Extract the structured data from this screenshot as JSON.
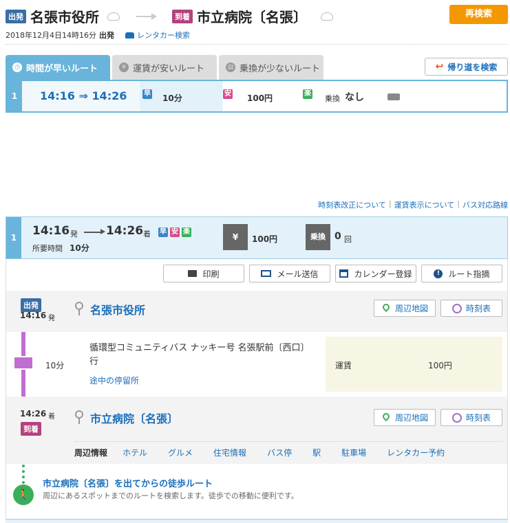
{
  "header": {
    "dep_badge": "出発",
    "dep_station": "名張市役所",
    "arr_badge": "到着",
    "arr_station": "市立病院〔名張〕",
    "research_button": "再検索",
    "datetime": "2018年12月4日14時16分",
    "datetime_suffix": "出発",
    "rental_link": "レンタカー検索"
  },
  "tabs": [
    {
      "label": "時間が早いルート",
      "icon": "clock-icon"
    },
    {
      "label": "運賃が安いルート",
      "icon": "yen-icon"
    },
    {
      "label": "乗換が少ないルート",
      "icon": "transfer-icon"
    }
  ],
  "return_button": "帰り道を検索",
  "summary": {
    "num": "1",
    "time": "14:16 ⇒ 14:26",
    "haya": "早",
    "duration": "10分",
    "yasu": "安",
    "fare": "100円",
    "raku": "楽",
    "transfer_label": "乗換",
    "transfer_value": "なし"
  },
  "links": {
    "timetable_revision": "時刻表改正について",
    "fare_display": "運賃表示について",
    "bus_lines": "バス対応路線"
  },
  "detail": {
    "num": "1",
    "dep_time": "14:16",
    "dep_suffix": "発",
    "arr_time": "14:26",
    "arr_suffix": "着",
    "haya": "早",
    "yasu": "安",
    "raku": "楽",
    "duration_label": "所要時間",
    "duration": "10分",
    "yen_box": "¥",
    "fare": "100円",
    "transfer_box": "乗換",
    "transfer_count": "0",
    "transfer_unit": "回"
  },
  "actions": {
    "print": "印刷",
    "mail": "メール送信",
    "calendar": "カレンダー登録",
    "route_point": "ルート指摘"
  },
  "departure": {
    "badge": "出発",
    "time": "14:16",
    "suffix": "発",
    "station": "名張市役所",
    "map_button": "周辺地図",
    "timetable_button": "時刻表"
  },
  "ride": {
    "minutes": "10分",
    "line_name": "循環型コミュニティバス ナッキー号 名張駅前〔西口〕行",
    "stops_link": "途中の停留所",
    "fare_label": "運賃",
    "fare_value": "100円"
  },
  "arrival": {
    "time": "14:26",
    "suffix": "着",
    "badge": "到着",
    "station": "市立病院〔名張〕",
    "map_button": "周辺地図",
    "timetable_button": "時刻表"
  },
  "nearby": {
    "label": "周辺情報",
    "items": [
      "ホテル",
      "グルメ",
      "住宅情報",
      "バス停",
      "駅",
      "駐車場",
      "レンタカー予約"
    ]
  },
  "walk": {
    "title": "市立病院〔名張〕を出てからの徒歩ルート",
    "desc": "周辺にあるスポットまでのルートを検索します。徒歩での移動に便利です。"
  },
  "colors": {
    "accent_blue": "#69b4db",
    "orange": "#f39800",
    "dep": "#3a6ea5",
    "arr": "#b3427d",
    "bus_line": "#c06fd0"
  }
}
